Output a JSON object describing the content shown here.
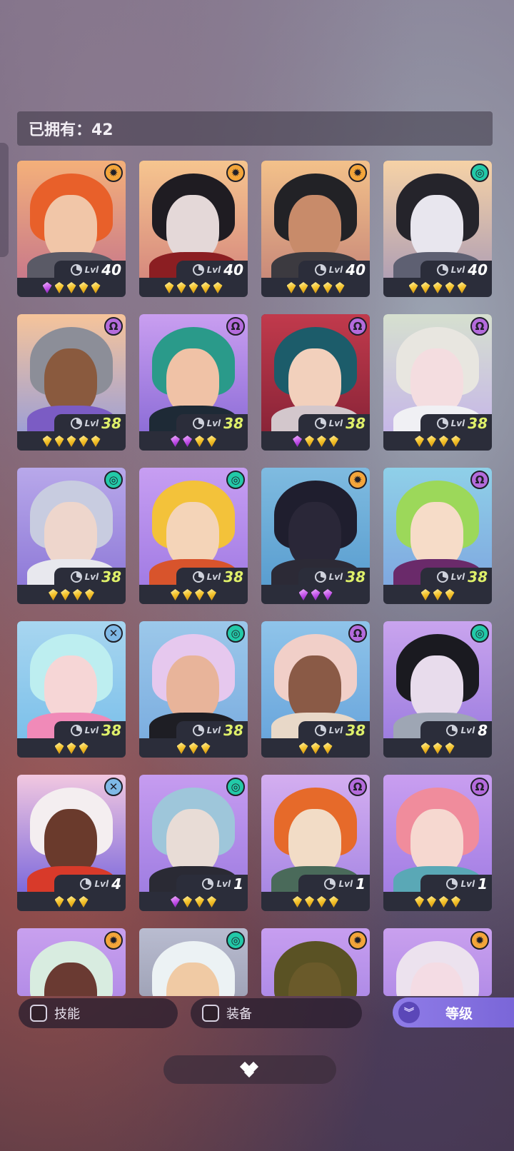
{
  "owned": {
    "label": "已拥有：42"
  },
  "factions": {
    "sun": {
      "glyph": "✹",
      "color": "#f3a53a"
    },
    "spiral": {
      "glyph": "◎",
      "color": "#22c9a8"
    },
    "omega": {
      "glyph": "Ω",
      "color": "#b46bdc"
    },
    "cross": {
      "glyph": "✕",
      "color": "#7fb9e6"
    }
  },
  "lvl_prefix": "Lvl",
  "heroes": [
    {
      "faction": "sun",
      "level": "40",
      "gems": [
        "purple",
        "gold",
        "gold",
        "gold",
        "gold"
      ],
      "bg": [
        "#f4b07a",
        "#c97a8a"
      ],
      "hair": "#e8602a",
      "face": "#f1c6a8",
      "body": "#5a5a66"
    },
    {
      "faction": "sun",
      "level": "40",
      "gems": [
        "gold",
        "gold",
        "gold",
        "gold",
        "gold"
      ],
      "bg": [
        "#f6c58f",
        "#d78a7e"
      ],
      "hair": "#1f1c22",
      "face": "#e4d8d8",
      "body": "#8b1e22"
    },
    {
      "faction": "sun",
      "level": "40",
      "gems": [
        "gold",
        "gold",
        "gold",
        "gold",
        "gold"
      ],
      "bg": [
        "#f3c18a",
        "#c98a7a"
      ],
      "hair": "#222226",
      "face": "#c88b6a",
      "body": "#3c3a40"
    },
    {
      "faction": "spiral",
      "level": "40",
      "gems": [
        "gold",
        "gold",
        "gold",
        "gold",
        "gold"
      ],
      "bg": [
        "#f6d2a6",
        "#b1a0b4"
      ],
      "hair": "#25242b",
      "face": "#e8e6ee",
      "body": "#5e6072"
    },
    {
      "faction": "omega",
      "level": "38",
      "gems": [
        "gold",
        "gold",
        "gold",
        "gold",
        "gold"
      ],
      "bg": [
        "#f6c49a",
        "#9fa0d4"
      ],
      "hair": "#8c8e98",
      "face": "#8a5a3e",
      "body": "#7b5cc4"
    },
    {
      "faction": "omega",
      "level": "38",
      "gems": [
        "purple",
        "purple",
        "gold",
        "gold"
      ],
      "bg": [
        "#c99ef0",
        "#8e6ed8"
      ],
      "hair": "#2a9a8a",
      "face": "#f0c2a6",
      "body": "#1e2a36"
    },
    {
      "faction": "omega",
      "level": "38",
      "gems": [
        "purple",
        "gold",
        "gold",
        "gold"
      ],
      "bg": [
        "#c13a4c",
        "#8a2438"
      ],
      "hair": "#1c5c6a",
      "face": "#f2d0bc",
      "body": "#d3c7cc"
    },
    {
      "faction": "omega",
      "level": "38",
      "gems": [
        "gold",
        "gold",
        "gold",
        "gold"
      ],
      "bg": [
        "#d6e0cf",
        "#c6b7e8"
      ],
      "hair": "#e8e6e0",
      "face": "#f4dde0",
      "body": "#f0f0f4"
    },
    {
      "faction": "spiral",
      "level": "38",
      "gems": [
        "gold",
        "gold",
        "gold",
        "gold"
      ],
      "bg": [
        "#b8a8ea",
        "#8f7ad8"
      ],
      "hair": "#c8cce0",
      "face": "#eed6cc",
      "body": "#e8e8ee"
    },
    {
      "faction": "spiral",
      "level": "38",
      "gems": [
        "gold",
        "gold",
        "gold",
        "gold"
      ],
      "bg": [
        "#c79ef2",
        "#a27ce4"
      ],
      "hair": "#f3c23a",
      "face": "#f4d4b8",
      "body": "#d8542c"
    },
    {
      "faction": "sun",
      "level": "38",
      "gems": [
        "purple",
        "purple",
        "purple"
      ],
      "bg": [
        "#7fbbe0",
        "#5a9ed0"
      ],
      "hair": "#1f1e2e",
      "face": "#2a2738",
      "body": "#2c2a36"
    },
    {
      "faction": "omega",
      "level": "38",
      "gems": [
        "gold",
        "gold",
        "gold"
      ],
      "bg": [
        "#8fd0e8",
        "#7fa8e0"
      ],
      "hair": "#9cd85a",
      "face": "#f6dcc8",
      "body": "#6a2a6a"
    },
    {
      "faction": "cross",
      "level": "38",
      "gems": [
        "gold",
        "gold",
        "gold"
      ],
      "bg": [
        "#a8d6f0",
        "#7cc0ea"
      ],
      "hair": "#bdeef0",
      "face": "#f6d6d6",
      "body": "#f08ab8"
    },
    {
      "faction": "spiral",
      "level": "38",
      "gems": [
        "gold",
        "gold",
        "gold"
      ],
      "bg": [
        "#9cc8ea",
        "#7caee0"
      ],
      "hair": "#e6c8ee",
      "face": "#e8b49a",
      "body": "#1e1e24"
    },
    {
      "faction": "omega",
      "level": "38",
      "gems": [
        "gold",
        "gold",
        "gold"
      ],
      "bg": [
        "#8fc4ea",
        "#6aa6dc"
      ],
      "hair": "#f1cfc8",
      "face": "#8a5a46",
      "body": "#e8d8c8"
    },
    {
      "faction": "spiral",
      "level": "8",
      "gems": [
        "gold",
        "gold",
        "gold"
      ],
      "bg": [
        "#c9a4ee",
        "#9e7ee0"
      ],
      "hair": "#1a1a20",
      "face": "#e8dcec",
      "body": "#9ea6b4"
    },
    {
      "faction": "cross",
      "level": "4",
      "gems": [
        "gold",
        "gold",
        "gold"
      ],
      "bg": [
        "#f2c8e0",
        "#7e6adc"
      ],
      "hair": "#f4eef0",
      "face": "#6a3a2c",
      "body": "#d83a2a"
    },
    {
      "faction": "spiral",
      "level": "1",
      "gems": [
        "purple",
        "gold",
        "gold",
        "gold"
      ],
      "bg": [
        "#c69cf0",
        "#a07ee2"
      ],
      "hair": "#9ec6da",
      "face": "#e8dcd6",
      "body": "#2a2a34"
    },
    {
      "faction": "omega",
      "level": "1",
      "gems": [
        "gold",
        "gold",
        "gold",
        "gold"
      ],
      "bg": [
        "#d4aef0",
        "#a888e4"
      ],
      "hair": "#e66a2a",
      "face": "#f2dcc6",
      "body": "#4a6a5a"
    },
    {
      "faction": "omega",
      "level": "1",
      "gems": [
        "gold",
        "gold",
        "gold",
        "gold"
      ],
      "bg": [
        "#c99ef0",
        "#a27ee4"
      ],
      "hair": "#f08c9c",
      "face": "#f6d8d0",
      "body": "#5aa8b6"
    },
    {
      "faction": "sun",
      "level": "",
      "gems": [],
      "bg": [
        "#c8a0ee",
        "#a47ee2"
      ],
      "hair": "#d8ece0",
      "face": "#6a3a32",
      "body": "#2a2a30"
    },
    {
      "faction": "spiral",
      "level": "",
      "gems": [],
      "bg": [
        "#b9bcd0",
        "#8e92a6"
      ],
      "hair": "#ecf2f4",
      "face": "#f0caa4",
      "body": "#22242e"
    },
    {
      "faction": "sun",
      "level": "",
      "gems": [],
      "bg": [
        "#c79ef0",
        "#9e7ee0"
      ],
      "hair": "#5a5224",
      "face": "#6a5a2a",
      "body": "#3a3428"
    },
    {
      "faction": "sun",
      "level": "",
      "gems": [],
      "bg": [
        "#c9a0ee",
        "#a27ee2"
      ],
      "hair": "#ece2ee",
      "face": "#f4dce4",
      "body": "#2a2030"
    }
  ],
  "filters": {
    "skill": "技能",
    "equipment": "装备"
  },
  "sort": {
    "label": "等级",
    "icon": "double-chevron-down-icon",
    "accent": "#8f7ce8"
  }
}
